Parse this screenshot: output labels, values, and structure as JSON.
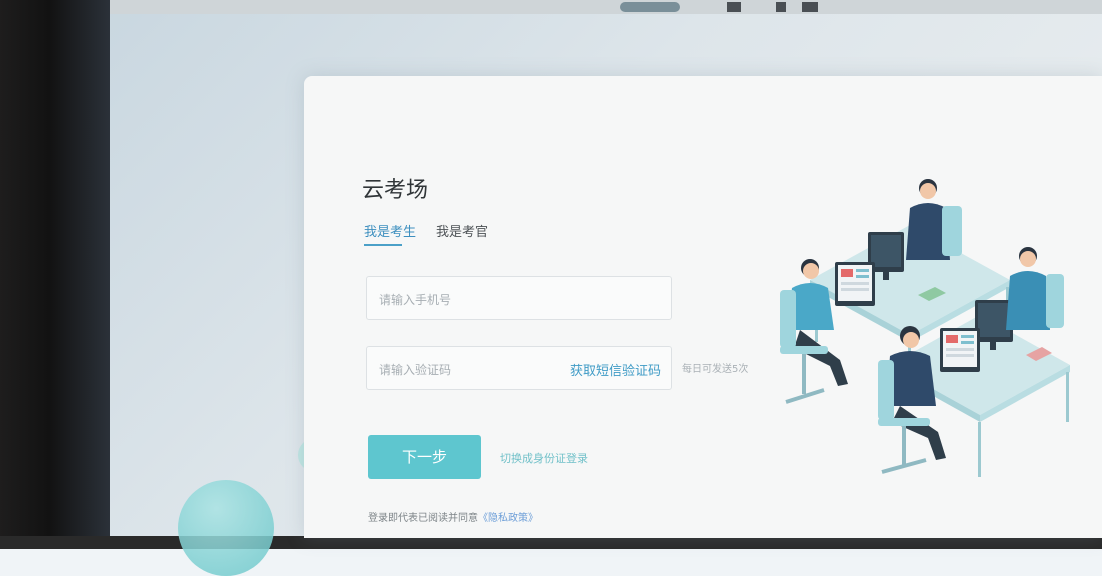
{
  "app": {
    "title": "云考场"
  },
  "tabs": [
    {
      "label": "我是考生",
      "active": true
    },
    {
      "label": "我是考官",
      "active": false
    }
  ],
  "form": {
    "phone_placeholder": "请输入手机号",
    "code_placeholder": "请输入验证码",
    "get_sms_code": "获取短信验证码",
    "daily_limit": "每日可发送5次",
    "next_button": "下一步",
    "switch_login": "切换成身份证登录",
    "agreement_prefix": "登录即代表已阅读并同意",
    "privacy_link": "《隐私政策》"
  },
  "colors": {
    "accent": "#5ec6cf",
    "link": "#3f9bc6",
    "tab_active": "#3d8fbf"
  },
  "illustration": {
    "icon": "office-workers-illustration"
  }
}
